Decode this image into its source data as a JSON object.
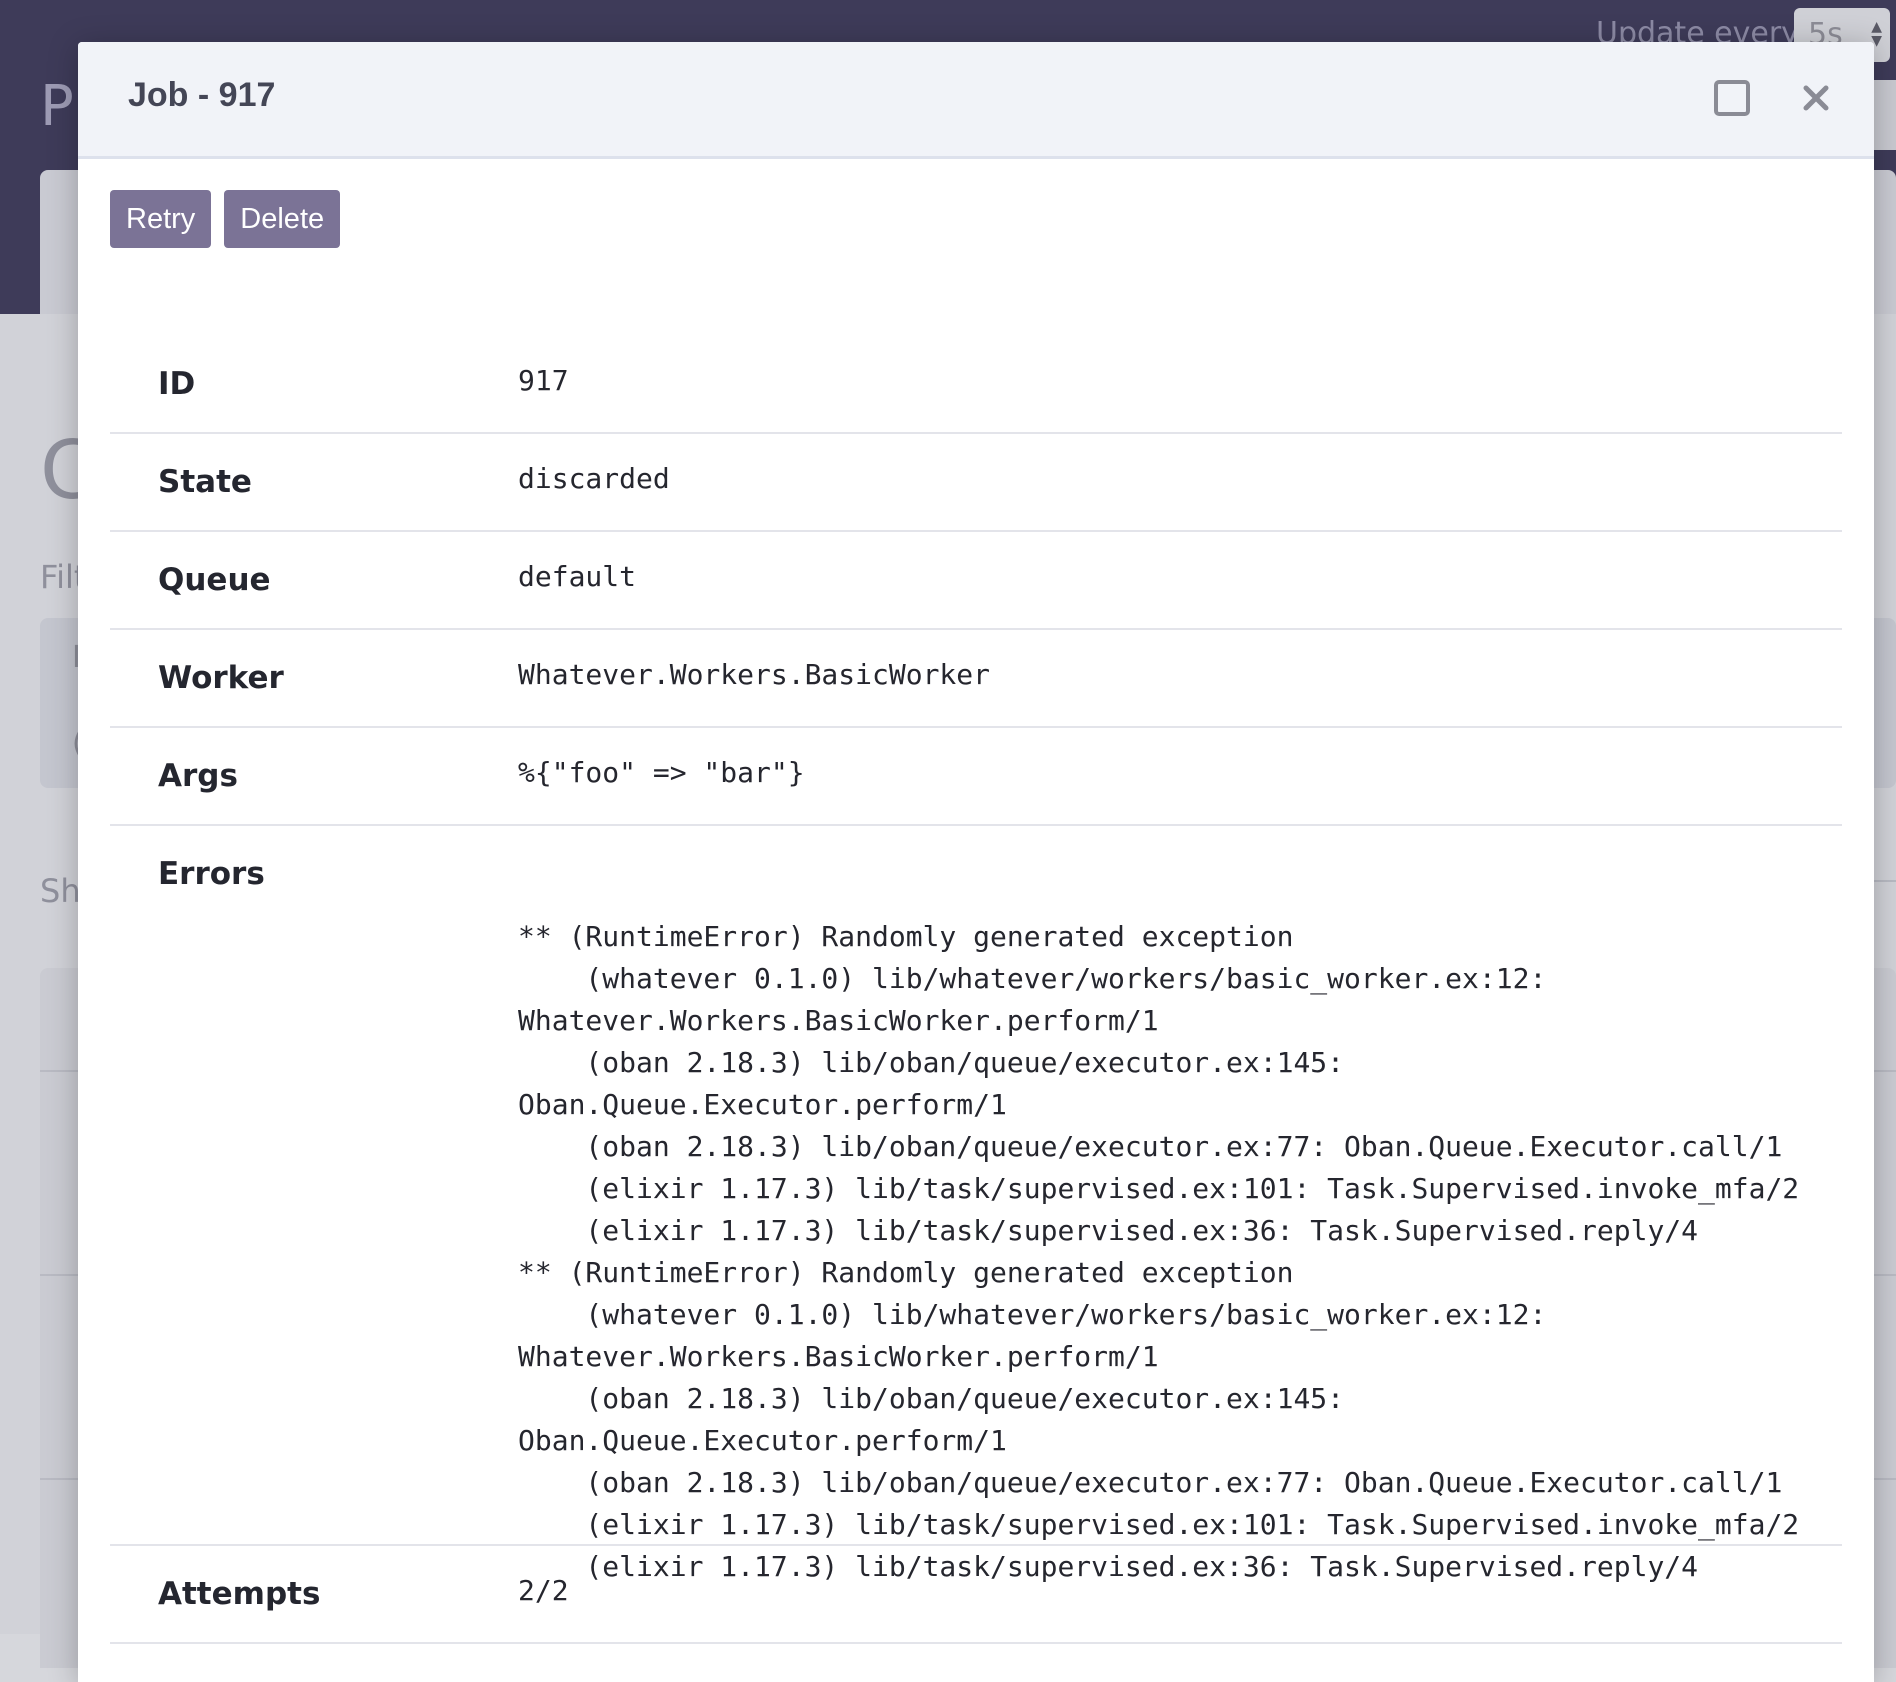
{
  "background": {
    "page_title_fragment": "P",
    "update_label": "Update every",
    "update_value": "5s",
    "section_title_fragment": "C",
    "filter_label_fragment": "Filt",
    "filter_item_1_fragment": "I",
    "filter_item_2_fragment": "(",
    "show_label_fragment": "Sh"
  },
  "modal": {
    "title": "Job - 917",
    "actions": {
      "retry_label": "Retry",
      "delete_label": "Delete"
    },
    "fields": {
      "id": {
        "label": "ID",
        "value": "917"
      },
      "state": {
        "label": "State",
        "value": "discarded"
      },
      "queue": {
        "label": "Queue",
        "value": "default"
      },
      "worker": {
        "label": "Worker",
        "value": "Whatever.Workers.BasicWorker"
      },
      "args": {
        "label": "Args",
        "value": "%{\"foo\" => \"bar\"}"
      },
      "errors": {
        "label": "Errors",
        "value": "** (RuntimeError) Randomly generated exception\n    (whatever 0.1.0) lib/whatever/workers/basic_worker.ex:12:\nWhatever.Workers.BasicWorker.perform/1\n    (oban 2.18.3) lib/oban/queue/executor.ex:145:\nOban.Queue.Executor.perform/1\n    (oban 2.18.3) lib/oban/queue/executor.ex:77: Oban.Queue.Executor.call/1\n    (elixir 1.17.3) lib/task/supervised.ex:101: Task.Supervised.invoke_mfa/2\n    (elixir 1.17.3) lib/task/supervised.ex:36: Task.Supervised.reply/4\n** (RuntimeError) Randomly generated exception\n    (whatever 0.1.0) lib/whatever/workers/basic_worker.ex:12:\nWhatever.Workers.BasicWorker.perform/1\n    (oban 2.18.3) lib/oban/queue/executor.ex:145:\nOban.Queue.Executor.perform/1\n    (oban 2.18.3) lib/oban/queue/executor.ex:77: Oban.Queue.Executor.call/1\n    (elixir 1.17.3) lib/task/supervised.ex:101: Task.Supervised.invoke_mfa/2\n    (elixir 1.17.3) lib/task/supervised.ex:36: Task.Supervised.reply/4"
      },
      "attempts": {
        "label": "Attempts",
        "value": "2/2"
      }
    }
  },
  "icons": {
    "maximize": "maximize-icon",
    "close": "close-icon"
  },
  "colors": {
    "header_bg": "#3e3b59",
    "button_bg": "#7b7396",
    "modal_header_bg": "#f1f3f8"
  }
}
